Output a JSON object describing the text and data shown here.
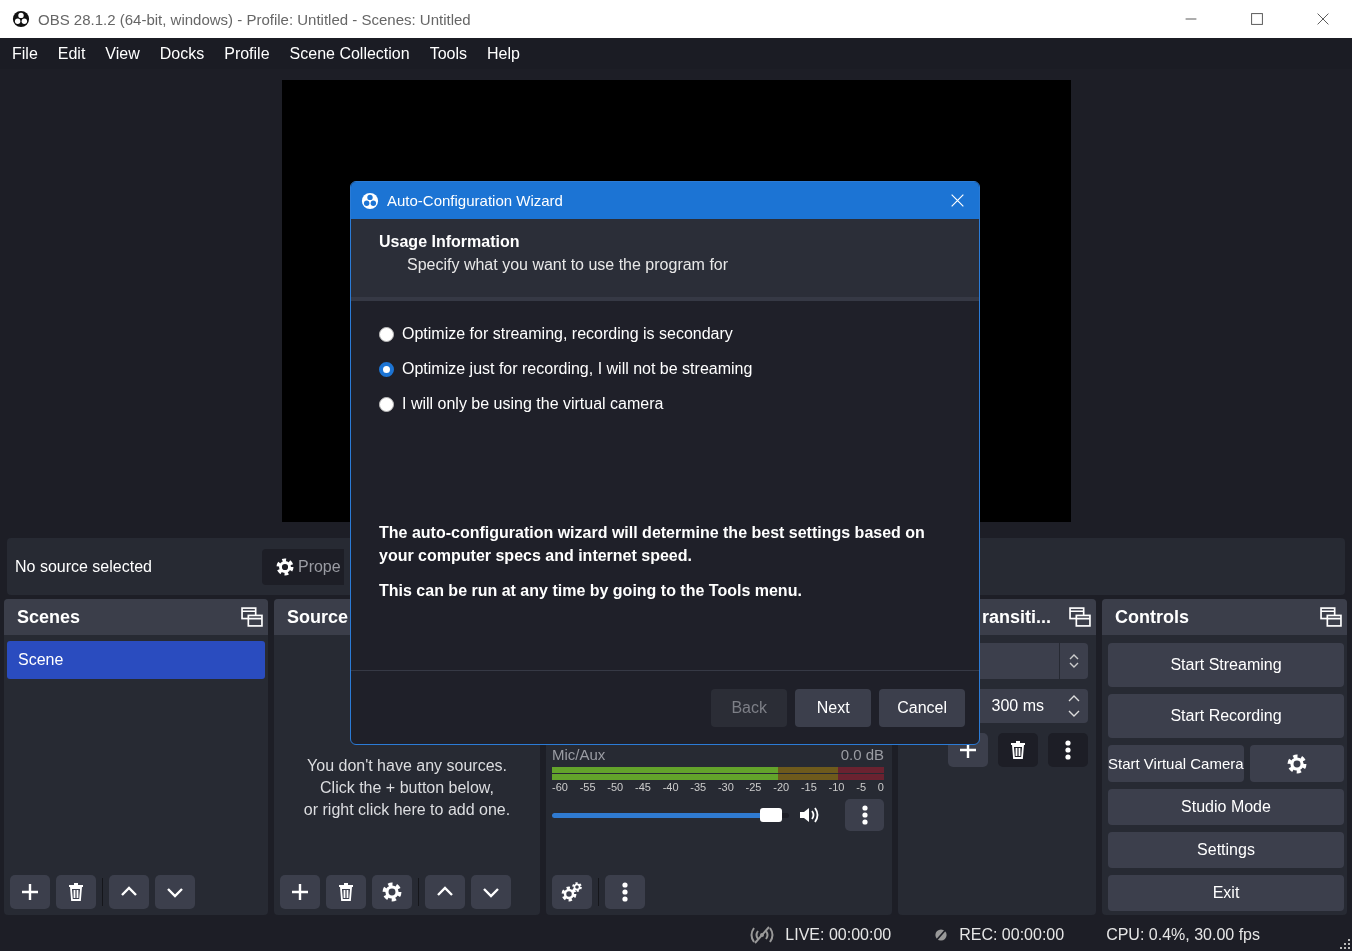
{
  "window": {
    "title": "OBS 28.1.2 (64-bit, windows) - Profile: Untitled - Scenes: Untitled"
  },
  "menu": [
    "File",
    "Edit",
    "View",
    "Docks",
    "Profile",
    "Scene Collection",
    "Tools",
    "Help"
  ],
  "source_bar": {
    "status": "No source selected",
    "properties_button": "Prope"
  },
  "scenes": {
    "title": "Scenes",
    "items": [
      {
        "label": "Scene",
        "selected": true
      }
    ]
  },
  "sources": {
    "title": "Source",
    "empty_message": "You don't have any sources.\nClick the + button below,\nor right click here to add one."
  },
  "mixer": {
    "channel": {
      "name": "Mic/Aux",
      "reading": "0.0 dB",
      "meter": {
        "level": 0.68
      },
      "ticks": [
        "-60",
        "-55",
        "-50",
        "-45",
        "-40",
        "-35",
        "-30",
        "-25",
        "-20",
        "-15",
        "-10",
        "-5",
        "0"
      ],
      "volume": {
        "level": 0.97
      }
    }
  },
  "transitions": {
    "title": "ransiti...",
    "duration": "300 ms"
  },
  "controls": {
    "title": "Controls",
    "buttons": [
      {
        "label": "Start Streaming",
        "kind": "plain"
      },
      {
        "label": "Start Recording",
        "kind": "plain"
      },
      {
        "label": "Start Virtual Camera",
        "kind": "split"
      },
      {
        "label": "Studio Mode",
        "kind": "plain"
      },
      {
        "label": "Settings",
        "kind": "plain"
      },
      {
        "label": "Exit",
        "kind": "plain"
      }
    ]
  },
  "dialog": {
    "title": "Auto-Configuration Wizard",
    "heading": "Usage Information",
    "subheading": "Specify what you want to use the program for",
    "options": [
      {
        "label": "Optimize for streaming, recording is secondary",
        "selected": false
      },
      {
        "label": "Optimize just for recording, I will not be streaming",
        "selected": true
      },
      {
        "label": "I will only be using the virtual camera",
        "selected": false
      }
    ],
    "notes": [
      "The auto-configuration wizard will determine the best settings based on your computer specs and internet speed.",
      "This can be run at any time by going to the Tools menu."
    ],
    "buttons": [
      {
        "label": "Back",
        "disabled": true
      },
      {
        "label": "Next",
        "disabled": false
      },
      {
        "label": "Cancel",
        "disabled": false
      }
    ]
  },
  "status_bar": {
    "live": "LIVE: 00:00:00",
    "rec": "REC: 00:00:00",
    "cpu": "CPU: 0.4%, 30.00 fps"
  }
}
